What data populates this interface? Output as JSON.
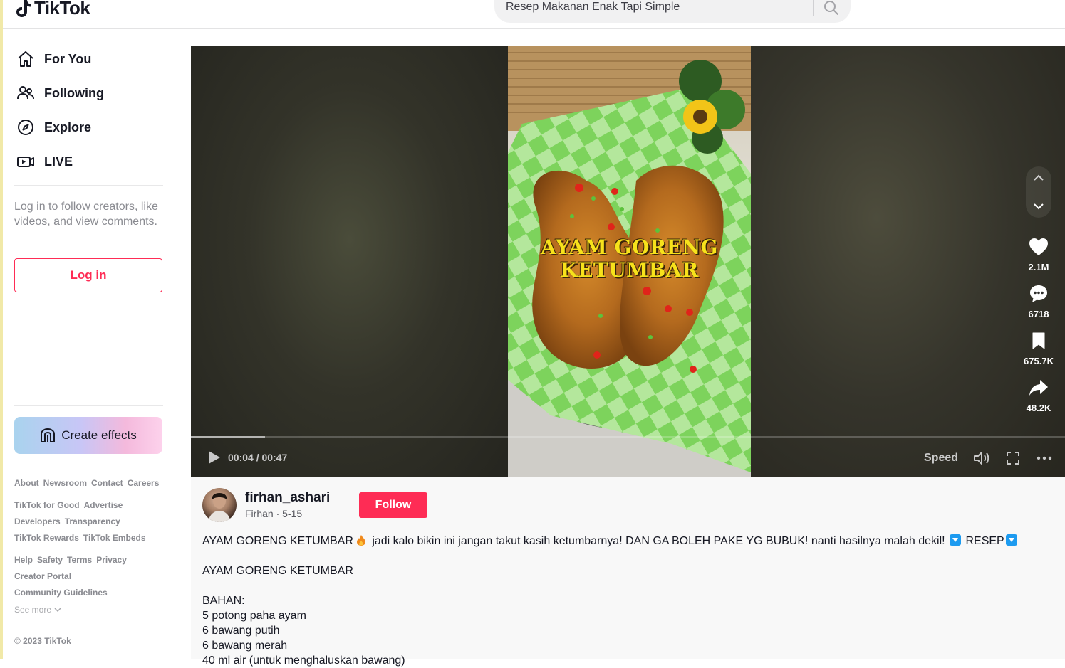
{
  "header": {
    "logo_text": "TikTok",
    "search_value": "Resep Makanan Enak Tapi Simple"
  },
  "sidebar": {
    "nav": [
      {
        "label": "For You",
        "icon": "home-icon"
      },
      {
        "label": "Following",
        "icon": "people-icon"
      },
      {
        "label": "Explore",
        "icon": "compass-icon"
      },
      {
        "label": "LIVE",
        "icon": "live-icon"
      }
    ],
    "login_hint": "Log in to follow creators, like videos, and view comments.",
    "login_label": "Log in",
    "effects_label": "Create effects",
    "footer_rows": [
      [
        "About",
        "Newsroom",
        "Contact",
        "Careers"
      ],
      [
        "TikTok for Good",
        "Advertise"
      ],
      [
        "Developers",
        "Transparency"
      ],
      [
        "TikTok Rewards",
        "TikTok Embeds"
      ],
      [
        "Help",
        "Safety",
        "Terms",
        "Privacy"
      ],
      [
        "Creator Portal"
      ],
      [
        "Community Guidelines"
      ]
    ],
    "see_more": "See more",
    "copyright": "© 2023 TikTok"
  },
  "video": {
    "overlay_line1": "AYAM GORENG",
    "overlay_line2": "KETUMBAR",
    "time": "00:04 / 00:47",
    "progress_fraction": 0.085,
    "speed_label": "Speed",
    "likes": "2.1M",
    "comments": "6718",
    "saves": "675.7K",
    "shares": "48.2K"
  },
  "post": {
    "username": "firhan_ashari",
    "sub": "Firhan · 5-15",
    "follow_label": "Follow",
    "desc_line1_a": "AYAM GORENG KETUMBAR",
    "desc_line1_b": "jadi kalo bikin ini jangan takut kasih ketumbarnya! DAN GA BOLEH PAKE YG BUBUK! nanti hasilnya malah dekil!",
    "desc_line1_c": "RESEP",
    "desc_title": "AYAM GORENG KETUMBAR",
    "desc_bahan": "BAHAN:",
    "ingredients": [
      "5 potong paha ayam",
      "6 bawang putih",
      "6 bawang merah",
      "40 ml air (untuk menghaluskan bawang)"
    ]
  },
  "colors": {
    "brand": "#fe2c55",
    "edge": "#f1e9a8"
  }
}
